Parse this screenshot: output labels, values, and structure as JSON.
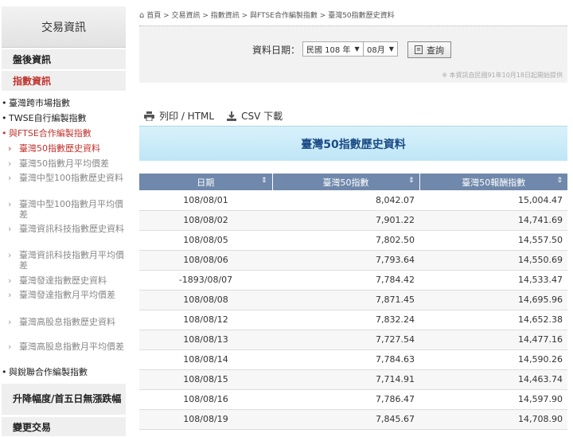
{
  "sidebar": {
    "header": "交易資訊",
    "sections": {
      "after_market": "盤後資訊",
      "index_info": "指數資訊",
      "limit_up_down": "升降幅度/首五日無漲跌幅",
      "change_trade": "變更交易"
    },
    "items": [
      {
        "label": "臺灣跨市場指數",
        "type": "top"
      },
      {
        "label": "TWSE自行編製指數",
        "type": "top"
      },
      {
        "label": "與FTSE合作編製指數",
        "type": "top-red"
      },
      {
        "label": "臺灣50指數歷史資料",
        "type": "sub-current"
      },
      {
        "label": "臺灣50指數月平均價差",
        "type": "sub"
      },
      {
        "label": "臺灣中型100指數歷史資料",
        "type": "sub"
      },
      {
        "label": "臺灣中型100指數月平均價差",
        "type": "sub"
      },
      {
        "label": "臺灣資訊科技指數歷史資料",
        "type": "sub"
      },
      {
        "label": "臺灣資訊科技指數月平均價差",
        "type": "sub"
      },
      {
        "label": "臺灣發達指數歷史資料",
        "type": "sub"
      },
      {
        "label": "臺灣發達指數月平均價差",
        "type": "sub"
      },
      {
        "label": "臺灣高股息指數歷史資料",
        "type": "sub"
      },
      {
        "label": "臺灣高股息指數月平均價差",
        "type": "sub"
      },
      {
        "label": "與銳聯合作編製指數",
        "type": "top"
      }
    ]
  },
  "breadcrumb": "首頁 > 交易資訊 > 指數資訊 > 與FTSE合作編製指數 > 臺灣50指數歷史資料",
  "query": {
    "label": "資料日期：",
    "year": "民國 108 年",
    "month": "08月",
    "button": "查詢",
    "note": "※ 本資訊自民國91年10月18日起開始提供"
  },
  "tools": {
    "print": "列印 / HTML",
    "csv": "CSV 下載"
  },
  "table": {
    "title": "臺灣50指數歷史資料",
    "headers": [
      "日期",
      "臺灣50指數",
      "臺灣50報酬指數"
    ],
    "rows": [
      [
        "108/08/01",
        "8,042.07",
        "15,004.47"
      ],
      [
        "108/08/02",
        "7,901.22",
        "14,741.69"
      ],
      [
        "108/08/05",
        "7,802.50",
        "14,557.50"
      ],
      [
        "108/08/06",
        "7,793.64",
        "14,550.69"
      ],
      [
        "-1893/08/07",
        "7,784.42",
        "14,533.47"
      ],
      [
        "108/08/08",
        "7,871.45",
        "14,695.96"
      ],
      [
        "108/08/12",
        "7,832.24",
        "14,652.38"
      ],
      [
        "108/08/13",
        "7,727.54",
        "14,477.16"
      ],
      [
        "108/08/14",
        "7,784.63",
        "14,590.26"
      ],
      [
        "108/08/15",
        "7,714.91",
        "14,463.74"
      ],
      [
        "108/08/16",
        "7,786.47",
        "14,597.90"
      ],
      [
        "108/08/19",
        "7,845.67",
        "14,708.90"
      ]
    ]
  },
  "icons": {
    "home": "home-icon",
    "dropdown": "chevron-down-icon",
    "sort": "sort-icon",
    "print": "printer-icon",
    "download": "download-icon",
    "search": "search-icon"
  }
}
